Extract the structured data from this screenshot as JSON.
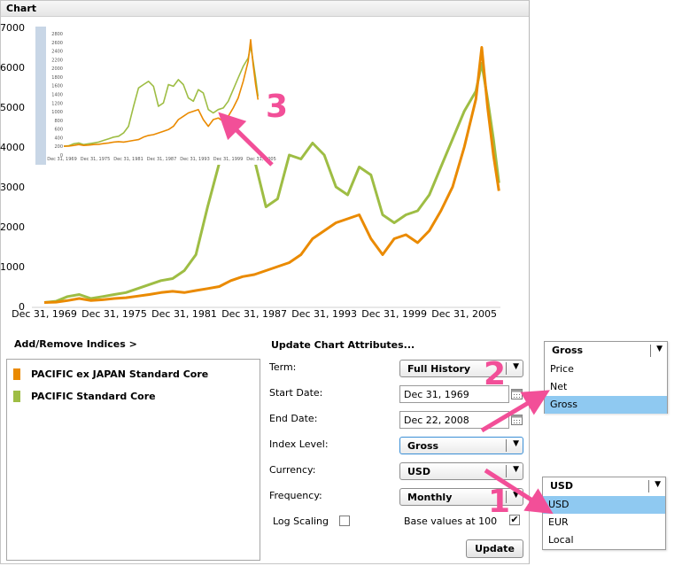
{
  "panel": {
    "title": "Chart"
  },
  "chart_data": {
    "type": "line",
    "ylim": [
      0,
      7000
    ],
    "yticks": [
      "0",
      "1000",
      "2000",
      "3000",
      "4000",
      "5000",
      "6000",
      "7000"
    ],
    "xticks": [
      "Dec 31, 1969",
      "Dec 31, 1975",
      "Dec 31, 1981",
      "Dec 31, 1987",
      "Dec 31, 1993",
      "Dec 31, 1999",
      "Dec 31, 2005"
    ],
    "x": [
      1970,
      1971,
      1972,
      1973,
      1974,
      1975,
      1976,
      1977,
      1978,
      1979,
      1980,
      1981,
      1982,
      1983,
      1984,
      1985,
      1986,
      1987,
      1988,
      1989,
      1990,
      1991,
      1992,
      1993,
      1994,
      1995,
      1996,
      1997,
      1998,
      1999,
      2000,
      2001,
      2002,
      2003,
      2004,
      2005,
      2006,
      2007,
      2007.5,
      2008,
      2008.5,
      2008.97
    ],
    "series": [
      {
        "name": "PACIFIC ex JAPAN Standard Core",
        "color": "#ea8a00",
        "values": [
          100,
          110,
          150,
          200,
          150,
          170,
          200,
          220,
          260,
          300,
          350,
          380,
          350,
          400,
          450,
          500,
          650,
          750,
          800,
          900,
          1000,
          1100,
          1300,
          1700,
          1900,
          2100,
          2200,
          2300,
          1700,
          1300,
          1700,
          1800,
          1600,
          1900,
          2400,
          3000,
          4000,
          5200,
          6500,
          5000,
          3800,
          2900
        ]
      },
      {
        "name": "PACIFIC Standard Core",
        "color": "#9ebd44",
        "values": [
          100,
          130,
          250,
          300,
          200,
          250,
          300,
          350,
          450,
          550,
          650,
          700,
          900,
          1300,
          2500,
          3600,
          3800,
          4000,
          3700,
          2500,
          2700,
          3800,
          3700,
          4100,
          3800,
          3000,
          2800,
          3500,
          3300,
          2300,
          2100,
          2300,
          2400,
          2800,
          3500,
          4200,
          4900,
          5400,
          6100,
          5200,
          4200,
          3100
        ]
      }
    ],
    "inset": {
      "yticks": [
        "2800",
        "2600",
        "2400",
        "2200",
        "2000",
        "1800",
        "1600",
        "1400",
        "1200",
        "1000",
        "800",
        "600",
        "400",
        "200",
        "0"
      ],
      "xticks": [
        "Dec 31, 1969",
        "Dec 31, 1975",
        "Dec 31, 1981",
        "Dec 31, 1987",
        "Dec 31, 1993",
        "Dec 31, 1999",
        "Dec 31, 2005"
      ]
    }
  },
  "legend": {
    "add_remove": "Add/Remove Indices >",
    "items": [
      {
        "label": "PACIFIC ex JAPAN Standard Core",
        "color": "#ea8a00"
      },
      {
        "label": "PACIFIC Standard Core",
        "color": "#9ebd44"
      }
    ]
  },
  "form": {
    "header": "Update Chart Attributes...",
    "term_label": "Term:",
    "term_value": "Full History",
    "start_label": "Start Date:",
    "start_value": "Dec 31, 1969",
    "end_label": "End Date:",
    "end_value": "Dec 22, 2008",
    "index_level_label": "Index Level:",
    "index_level_value": "Gross",
    "currency_label": "Currency:",
    "currency_value": "USD",
    "frequency_label": "Frequency:",
    "frequency_value": "Monthly",
    "log_scaling_label": "Log Scaling",
    "log_scaling_checked": false,
    "base_values_label": "Base values at 100",
    "base_values_checked": true,
    "update_label": "Update"
  },
  "index_level_dropdown": {
    "value": "Gross",
    "options": [
      "Price",
      "Net",
      "Gross"
    ],
    "selected": "Gross"
  },
  "currency_dropdown": {
    "value": "USD",
    "options": [
      "USD",
      "EUR",
      "Local"
    ],
    "selected": "USD"
  },
  "callouts": [
    "1",
    "2",
    "3"
  ],
  "colors": {
    "accent": "#f24f98",
    "selection": "#8fc9f1",
    "orange": "#ea8a00",
    "green": "#9ebd44"
  },
  "icons": {
    "dropdown_arrow": "▼",
    "calendar": "calendar-icon",
    "check": "✔"
  }
}
